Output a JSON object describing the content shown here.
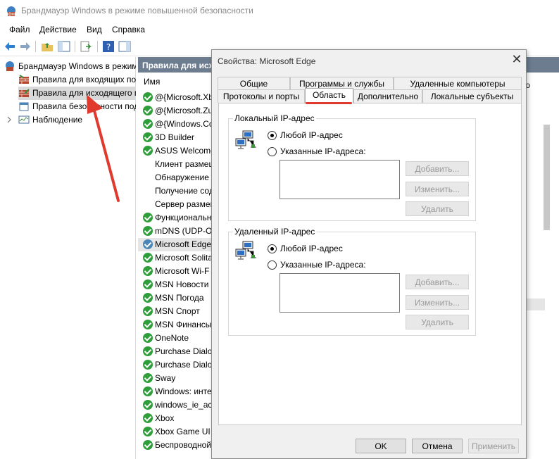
{
  "window": {
    "title": "Брандмауэр Windows в режиме повышенной безопасности"
  },
  "menu": {
    "items": [
      "Файл",
      "Действие",
      "Вид",
      "Справка"
    ]
  },
  "tree": {
    "items": [
      {
        "label": "Брандмауэр Windows в режим"
      },
      {
        "label": "Правила для входящих под"
      },
      {
        "label": "Правила для исходящего п"
      },
      {
        "label": "Правила безопасности под"
      },
      {
        "label": "Наблюдение"
      }
    ]
  },
  "list": {
    "header": "Правила для исх",
    "column_name": "Имя",
    "rows": [
      {
        "name": "@{Microsoft.Xb",
        "checked": true
      },
      {
        "name": "@{Microsoft.Zu",
        "checked": true
      },
      {
        "name": "@{Windows.Co",
        "checked": true
      },
      {
        "name": "3D Builder",
        "checked": true
      },
      {
        "name": "ASUS Welcome",
        "checked": true
      },
      {
        "name": "Клиент размец",
        "checked": false
      },
      {
        "name": "Обнаружение",
        "checked": false
      },
      {
        "name": "Получение сод",
        "checked": false
      },
      {
        "name": "Сервер размец",
        "checked": false
      },
      {
        "name": "Функциональн",
        "checked": true
      },
      {
        "name": "mDNS (UDP-Ou",
        "checked": true
      },
      {
        "name": "Microsoft Edge",
        "checked": true
      },
      {
        "name": "Microsoft Solita",
        "checked": true
      },
      {
        "name": "Microsoft Wi-F",
        "checked": true
      },
      {
        "name": "MSN Новости",
        "checked": true
      },
      {
        "name": "MSN Погода",
        "checked": true
      },
      {
        "name": "MSN Спорт",
        "checked": true
      },
      {
        "name": "MSN Финансы",
        "checked": true
      },
      {
        "name": "OneNote",
        "checked": true
      },
      {
        "name": "Purchase Dialog",
        "checked": true
      },
      {
        "name": "Purchase Dialog",
        "checked": true
      },
      {
        "name": "Sway",
        "checked": true
      },
      {
        "name": "Windows: инте",
        "checked": true
      },
      {
        "name": "windows_ie_ac_",
        "checked": true
      },
      {
        "name": "Xbox",
        "checked": true
      },
      {
        "name": "Xbox Game UI",
        "checked": true
      },
      {
        "name": "Беспроводной",
        "checked": true
      }
    ]
  },
  "right_strip": {
    "hint": "ю"
  },
  "dialog": {
    "title": "Свойства: Microsoft Edge",
    "close_glyph": "✕",
    "tabs_row1": [
      "Общие",
      "Программы и службы",
      "Удаленные компьютеры"
    ],
    "tabs_row2": [
      "Протоколы и порты",
      "Область",
      "Дополнительно",
      "Локальные субъекты"
    ],
    "local": {
      "legend": "Локальный IP-адрес",
      "any_label": "Любой IP-адрес",
      "specific_label": "Указанные IP-адреса:",
      "add": "Добавить...",
      "edit": "Изменить...",
      "remove": "Удалить"
    },
    "remote": {
      "legend": "Удаленный IP-адрес",
      "any_label": "Любой IP-адрес",
      "specific_label": "Указанные IP-адреса:",
      "add": "Добавить...",
      "edit": "Изменить...",
      "remove": "Удалить"
    },
    "ok": "OK",
    "cancel": "Отмена",
    "apply": "Применить"
  },
  "colors": {
    "accent_red": "#e03a2f",
    "header_bg": "#6d7d8f",
    "check_green": "#2e9e3a"
  }
}
